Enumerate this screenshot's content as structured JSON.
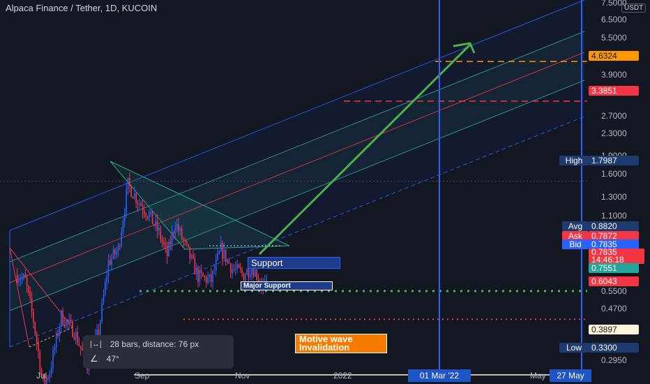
{
  "header": {
    "title": "Alpaca Finance / Tether, 1D, KUCOIN",
    "currency_badge": "USDT"
  },
  "colors": {
    "background": "#131722",
    "bull_candle": "#2962ff",
    "bear_candle": "#f23645",
    "channel_blue": "#2962ff",
    "channel_teal": "#26a69a",
    "channel_red": "#f23645",
    "arrow_green": "#4caf50",
    "orange": "#ff9800",
    "white_line": "#fff3d9"
  },
  "y_axis": {
    "ticks": [
      "7.5000",
      "6.5000",
      "5.5000",
      "4.6324",
      "3.9000",
      "3.3851",
      "2.7000",
      "2.3000",
      "1.9000",
      "1.6000",
      "1.3000",
      "1.1000",
      "0.8820",
      "0.7872",
      "0.7835",
      "0.7551",
      "0.6043",
      "0.5500",
      "0.4700",
      "0.3897",
      "0.3300",
      "0.2950"
    ],
    "plain_ticks": [
      "7.5000",
      "6.5000",
      "5.5000",
      "3.9000",
      "2.7000",
      "2.3000",
      "1.9000",
      "1.6000",
      "1.3000",
      "1.1000",
      "0.5500",
      "0.4700",
      "0.2950"
    ]
  },
  "price_labels": {
    "high_label": "High",
    "high_value": "1.7987",
    "avg_label": "Avg",
    "avg_value": "0.8820",
    "ask_label": "Ask",
    "ask_value": "0.7872",
    "bid_label": "Bid",
    "bid_value": "0.7835",
    "last_value": "0.7835",
    "countdown": "14:46:18",
    "green_value": "0.7551",
    "major_value": "0.6043",
    "invalid_value": "0.3897",
    "low_label": "Low",
    "low_value": "0.3300",
    "target_orange": "4.6324",
    "target_red": "3.3851"
  },
  "x_axis": {
    "labels": [
      "Jul",
      "Sep",
      "Nov",
      "2022",
      "May"
    ],
    "highlight_1": "01 Mar '22",
    "highlight_2": "27 May"
  },
  "annotations": {
    "support": "Support",
    "major_support": "Major Support",
    "invalidation": "Motive wave\nInvalidation"
  },
  "measure_popup": {
    "bars_text": "28 bars, distance: 76 px",
    "angle_text": "47°"
  },
  "chart_data": {
    "type": "candlestick",
    "title": "Alpaca Finance / Tether, 1D, KUCOIN",
    "scale": "log",
    "ylim": [
      0.28,
      7.6
    ],
    "x_range": [
      "2021-06-15",
      "2022-06-01"
    ],
    "x_ticks": [
      "Jul",
      "Sep",
      "Nov",
      "2022",
      "May"
    ],
    "price_path": [
      {
        "date": "2021-06-15",
        "price": 0.86
      },
      {
        "date": "2021-06-20",
        "price": 0.82
      },
      {
        "date": "2021-06-25",
        "price": 0.6
      },
      {
        "date": "2021-07-01",
        "price": 0.36
      },
      {
        "date": "2021-07-05",
        "price": 0.4
      },
      {
        "date": "2021-07-12",
        "price": 0.62
      },
      {
        "date": "2021-07-20",
        "price": 0.55
      },
      {
        "date": "2021-07-28",
        "price": 0.42
      },
      {
        "date": "2021-08-04",
        "price": 0.55
      },
      {
        "date": "2021-08-10",
        "price": 0.95
      },
      {
        "date": "2021-08-16",
        "price": 1.05
      },
      {
        "date": "2021-08-22",
        "price": 1.75
      },
      {
        "date": "2021-08-28",
        "price": 1.55
      },
      {
        "date": "2021-09-03",
        "price": 1.4
      },
      {
        "date": "2021-09-10",
        "price": 1.2
      },
      {
        "date": "2021-09-15",
        "price": 1.0
      },
      {
        "date": "2021-09-20",
        "price": 1.3
      },
      {
        "date": "2021-09-27",
        "price": 1.05
      },
      {
        "date": "2021-10-04",
        "price": 0.85
      },
      {
        "date": "2021-10-12",
        "price": 0.82
      },
      {
        "date": "2021-10-18",
        "price": 1.05
      },
      {
        "date": "2021-10-25",
        "price": 0.9
      },
      {
        "date": "2021-11-01",
        "price": 0.86
      },
      {
        "date": "2021-11-06",
        "price": 0.92
      },
      {
        "date": "2021-11-12",
        "price": 0.8
      },
      {
        "date": "2021-11-15",
        "price": 0.7835
      }
    ],
    "horizontal_levels": [
      {
        "label": "Support",
        "value": 0.7551,
        "style": "dotted",
        "color": "#4caf50"
      },
      {
        "label": "Major Support",
        "value": 0.6043,
        "style": "dotted",
        "color": "#f23645"
      },
      {
        "label": "Motive wave Invalidation",
        "value": 0.3897,
        "style": "solid",
        "color": "#fff3d9"
      },
      {
        "value": 4.6324,
        "style": "dashed",
        "color": "#ff9800"
      },
      {
        "value": 3.3851,
        "style": "dashed",
        "color": "#f23645"
      }
    ],
    "vertical_markers": [
      "01 Mar '22",
      "27 May"
    ],
    "stats": {
      "high": 1.7987,
      "low": 0.33,
      "avg": 0.882,
      "ask": 0.7872,
      "bid": 0.7835,
      "last": 0.7835
    }
  }
}
